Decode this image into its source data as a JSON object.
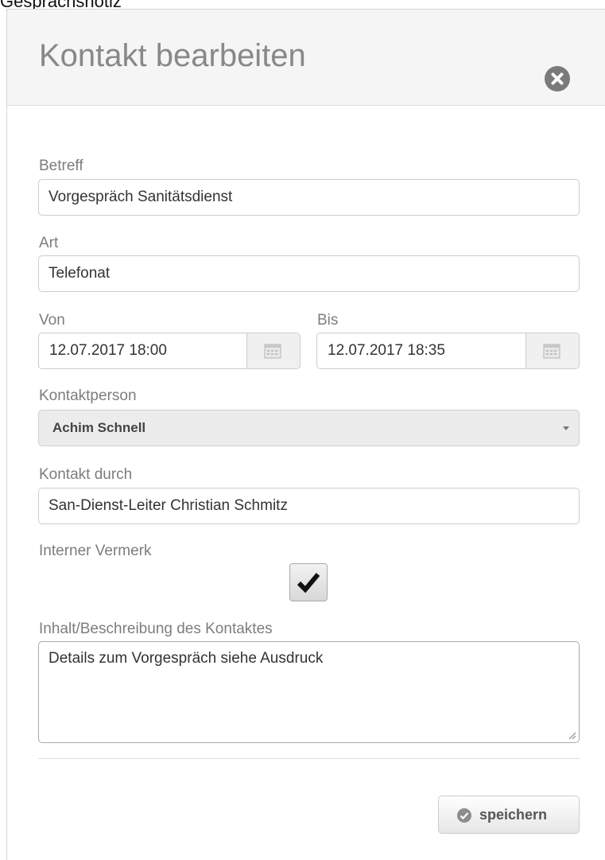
{
  "top_cut_text": "Gesprächsnotiz",
  "dialog": {
    "title": "Kontakt bearbeiten",
    "close_icon": "close-circle-icon"
  },
  "form": {
    "betreff": {
      "label": "Betreff",
      "value": "Vorgespräch Sanitätsdienst"
    },
    "art": {
      "label": "Art",
      "value": "Telefonat"
    },
    "von": {
      "label": "Von",
      "value": "12.07.2017 18:00",
      "icon": "calendar-icon"
    },
    "bis": {
      "label": "Bis",
      "value": "12.07.2017 18:35",
      "icon": "calendar-icon"
    },
    "kontaktperson": {
      "label": "Kontaktperson",
      "value": "Achim Schnell",
      "icon": "caret-down-icon"
    },
    "kontakt_durch": {
      "label": "Kontakt durch",
      "value": "San-Dienst-Leiter Christian Schmitz"
    },
    "interner_vermerk": {
      "label": "Interner Vermerk",
      "checked": true,
      "icon": "checkmark-icon"
    },
    "inhalt": {
      "label": "Inhalt/Beschreibung des Kontaktes",
      "value": "Details zum Vorgespräch siehe Ausdruck"
    }
  },
  "footer": {
    "save_label": "speichern",
    "save_icon": "check-circle-icon"
  },
  "colors": {
    "header_bg": "#f5f5f5",
    "title_text": "#888888",
    "label_text": "#7d7d7d",
    "input_border": "#cccccc"
  }
}
